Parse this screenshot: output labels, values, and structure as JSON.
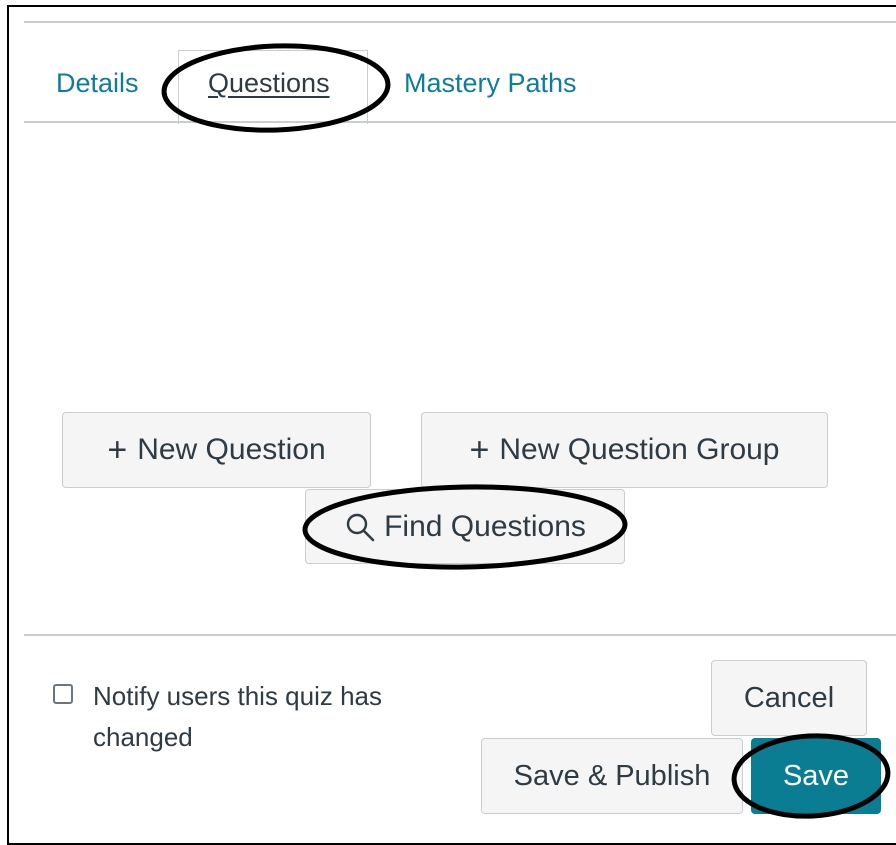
{
  "tabs": [
    {
      "label": "Details",
      "active": false
    },
    {
      "label": "Questions",
      "active": true
    },
    {
      "label": "Mastery Paths",
      "active": false
    }
  ],
  "question_actions": {
    "new_question_label": "New Question",
    "new_group_label": "New Question Group",
    "find_questions_label": "Find Questions"
  },
  "footer": {
    "notify_label": "Notify users this quiz has changed",
    "notify_checked": false,
    "cancel_label": "Cancel",
    "save_publish_label": "Save & Publish",
    "save_label": "Save"
  },
  "colors": {
    "link": "#0c7d9c",
    "primary_button": "#0b7d93",
    "annotation_ring": "#000000"
  },
  "icons": [
    "plus-icon",
    "search-icon"
  ]
}
